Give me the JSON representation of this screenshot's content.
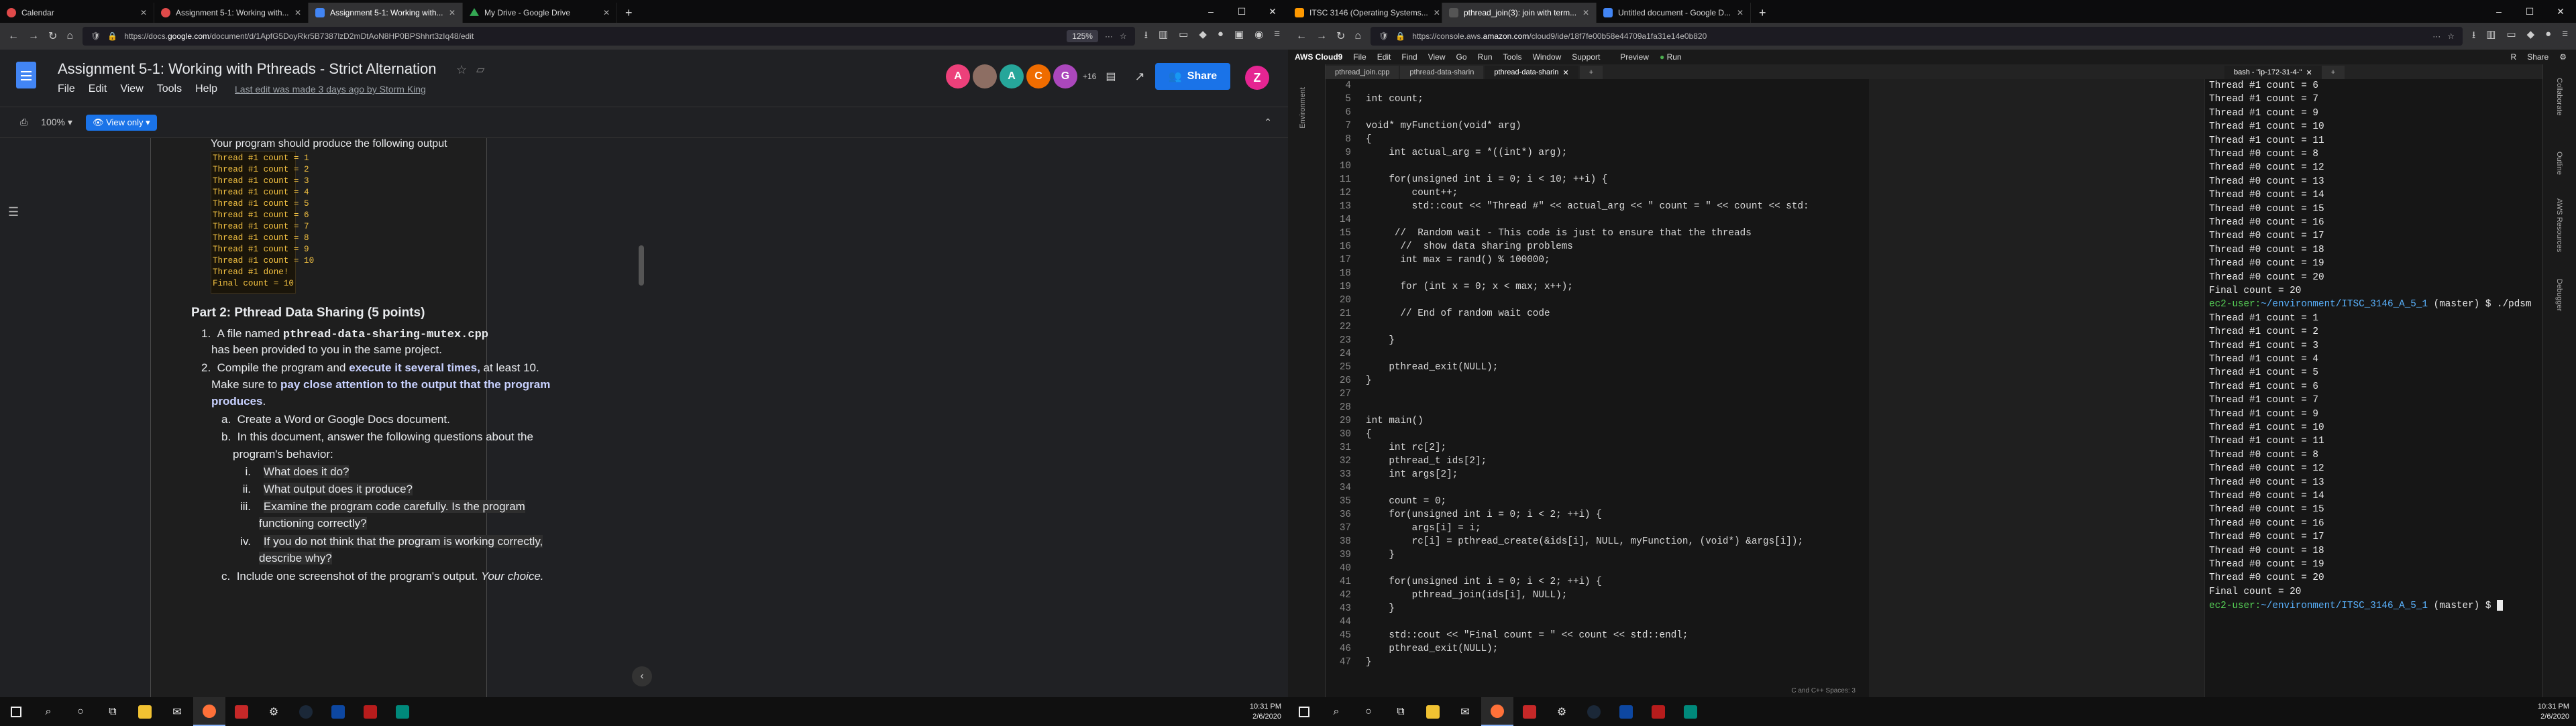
{
  "left": {
    "tabs": [
      {
        "label": "Calendar",
        "color": "#e04a4a"
      },
      {
        "label": "Assignment 5-1: Working with...",
        "color": "#e04a4a"
      },
      {
        "label": "Assignment 5-1: Working with...",
        "color": "#4285f4"
      },
      {
        "label": "My Drive - Google Drive",
        "color": "#34a853"
      }
    ],
    "url_prefix": "https://docs.",
    "url_domain": "google.com",
    "url_rest": "/document/d/1ApfG5DoyRkr5B7387lzD2mDtAoN8HP0BPShhrt3zIq48/edit",
    "zoom": "125%",
    "doc_title": "Assignment 5-1: Working with Pthreads - Strict Alternation",
    "menu": [
      "File",
      "Edit",
      "View",
      "Tools",
      "Help"
    ],
    "last_edit": "Last edit was made 3 days ago by Storm King",
    "avatars": [
      {
        "letter": "A",
        "color": "#ec407a"
      },
      {
        "letter": "",
        "color": "#8d6e63"
      },
      {
        "letter": "A",
        "color": "#26a69a"
      },
      {
        "letter": "C",
        "color": "#ef6c00"
      },
      {
        "letter": "G",
        "color": "#ab47bc"
      }
    ],
    "avatar_more": "+16",
    "share_label": "Share",
    "profile_letter": "Z",
    "zoom_select": "100%",
    "view_only": "View only",
    "output_intro": "Your program should produce the following output",
    "output_lines": [
      "Thread #1 count = 1",
      "Thread #1 count = 2",
      "Thread #1 count = 3",
      "Thread #1 count = 4",
      "Thread #1 count = 5",
      "Thread #1 count = 6",
      "Thread #1 count = 7",
      "Thread #1 count = 8",
      "Thread #1 count = 9",
      "Thread #1 count = 10",
      "Thread #1 done!",
      "Final count = 10"
    ],
    "part2_heading": "Part 2: Pthread Data Sharing (5 points)",
    "item1_num": "1.",
    "item1_a": "A file named ",
    "item1_file": "pthread-data-sharing-mutex.cpp",
    "item1_b": "has been provided to you in the same project.",
    "item2_num": "2.",
    "item2_a": "Compile the program and ",
    "item2_bold": "execute it several times,",
    "item2_c": " at least 10.",
    "item2_d": "Make sure to ",
    "item2_e": "pay close attention to the output that the program",
    "item2_f": "produces",
    "item2_g": ".",
    "sub_a_num": "a.",
    "sub_a": "Create a Word or Google Docs document.",
    "sub_b_num": "b.",
    "sub_b1": "In this document, answer the following questions about the",
    "sub_b2": "program's behavior:",
    "q1_num": "i.",
    "q1": "What does it do?",
    "q2_num": "ii.",
    "q2": "What output does it produce?",
    "q3_num": "iii.",
    "q3a": "Examine the program code carefully. Is the program",
    "q3b": "functioning correctly?",
    "q4_num": "iv.",
    "q4a": "If you do not think that the program is working correctly,",
    "q4b": "describe why?",
    "sub_c_num": "c.",
    "sub_c": "Include one screenshot of the program's output. ",
    "sub_c_it": "Your choice.",
    "time": "10:31 PM",
    "date": "2/6/2020"
  },
  "right": {
    "tabs": [
      {
        "label": "ITSC 3146 (Operating Systems...",
        "color": "#ff9900"
      },
      {
        "label": "pthread_join(3): join with term...",
        "color": "#555555"
      },
      {
        "label": "Untitled document - Google D...",
        "color": "#4285f4"
      }
    ],
    "url_prefix": "https://console.aws.",
    "url_domain": "amazon.com",
    "url_rest": "/cloud9/ide/18f7fe00b58e44709a1fa31e14e0b820",
    "c9_brand": "AWS Cloud9",
    "c9_menu": [
      "File",
      "Edit",
      "Find",
      "View",
      "Go",
      "Run",
      "Tools",
      "Window",
      "Support"
    ],
    "c9_preview": "Preview",
    "c9_run": "Run",
    "c9_share": "Share",
    "editor_tabs": [
      "pthread_join.cpp",
      "pthread-data-sharin",
      "pthread-data-sharin"
    ],
    "term_tab": "bash - \"ip-172-31-4-\"",
    "side_label": "Environment",
    "rail_labels": [
      "Collaborate",
      "Outline",
      "AWS Resources",
      "Debugger"
    ],
    "code_lines": [
      {
        "n": "4",
        "t": ""
      },
      {
        "n": "5",
        "t": "int count;"
      },
      {
        "n": "6",
        "t": ""
      },
      {
        "n": "7",
        "t": "void* myFunction(void* arg)"
      },
      {
        "n": "8",
        "t": "{"
      },
      {
        "n": "9",
        "t": "    int actual_arg = *((int*) arg);"
      },
      {
        "n": "10",
        "t": ""
      },
      {
        "n": "11",
        "t": "    for(unsigned int i = 0; i < 10; ++i) {"
      },
      {
        "n": "12",
        "t": "        count++;"
      },
      {
        "n": "13",
        "t": "        std::cout << \"Thread #\" << actual_arg << \" count = \" << count << std:"
      },
      {
        "n": "14",
        "t": ""
      },
      {
        "n": "15",
        "t": "     //  Random wait - This code is just to ensure that the threads"
      },
      {
        "n": "16",
        "t": "      //  show data sharing problems"
      },
      {
        "n": "17",
        "t": "      int max = rand() % 100000;"
      },
      {
        "n": "18",
        "t": ""
      },
      {
        "n": "19",
        "t": "      for (int x = 0; x < max; x++);"
      },
      {
        "n": "20",
        "t": ""
      },
      {
        "n": "21",
        "t": "      // End of random wait code"
      },
      {
        "n": "22",
        "t": ""
      },
      {
        "n": "23",
        "t": "    }"
      },
      {
        "n": "24",
        "t": ""
      },
      {
        "n": "25",
        "t": "    pthread_exit(NULL);"
      },
      {
        "n": "26",
        "t": "}"
      },
      {
        "n": "27",
        "t": ""
      },
      {
        "n": "28",
        "t": ""
      },
      {
        "n": "29",
        "t": "int main()"
      },
      {
        "n": "30",
        "t": "{"
      },
      {
        "n": "31",
        "t": "    int rc[2];"
      },
      {
        "n": "32",
        "t": "    pthread_t ids[2];"
      },
      {
        "n": "33",
        "t": "    int args[2];"
      },
      {
        "n": "34",
        "t": ""
      },
      {
        "n": "35",
        "t": "    count = 0;"
      },
      {
        "n": "36",
        "t": "    for(unsigned int i = 0; i < 2; ++i) {"
      },
      {
        "n": "37",
        "t": "        args[i] = i;"
      },
      {
        "n": "38",
        "t": "        rc[i] = pthread_create(&ids[i], NULL, myFunction, (void*) &args[i]);"
      },
      {
        "n": "39",
        "t": "    }"
      },
      {
        "n": "40",
        "t": ""
      },
      {
        "n": "41",
        "t": "    for(unsigned int i = 0; i < 2; ++i) {"
      },
      {
        "n": "42",
        "t": "        pthread_join(ids[i], NULL);"
      },
      {
        "n": "43",
        "t": "    }"
      },
      {
        "n": "44",
        "t": ""
      },
      {
        "n": "45",
        "t": "    std::cout << \"Final count = \" << count << std::endl;"
      },
      {
        "n": "46",
        "t": "    pthread_exit(NULL);"
      },
      {
        "n": "47",
        "t": "}"
      }
    ],
    "editor_status": "C and C++   Spaces: 3",
    "term_lines": [
      {
        "t": "Thread #1 count = 6"
      },
      {
        "t": "Thread #1 count = 7"
      },
      {
        "t": "Thread #1 count = 9"
      },
      {
        "t": "Thread #1 count = 10"
      },
      {
        "t": "Thread #1 count = 11"
      },
      {
        "t": "Thread #0 count = 8"
      },
      {
        "t": "Thread #0 count = 12"
      },
      {
        "t": "Thread #0 count = 13"
      },
      {
        "t": "Thread #0 count = 14"
      },
      {
        "t": "Thread #0 count = 15"
      },
      {
        "t": "Thread #0 count = 16"
      },
      {
        "t": "Thread #0 count = 17"
      },
      {
        "t": "Thread #0 count = 18"
      },
      {
        "t": "Thread #0 count = 19"
      },
      {
        "t": "Thread #0 count = 20"
      },
      {
        "t": "Final count = 20"
      },
      {
        "p": "ec2-user:",
        "d": "~/environment/ITSC_3146_A_5_1",
        "c": " (master) $ ./pdsm"
      },
      {
        "t": "Thread #1 count = 1"
      },
      {
        "t": "Thread #1 count = 2"
      },
      {
        "t": "Thread #1 count = 3"
      },
      {
        "t": "Thread #1 count = 4"
      },
      {
        "t": "Thread #1 count = 5"
      },
      {
        "t": "Thread #1 count = 6"
      },
      {
        "t": "Thread #1 count = 7"
      },
      {
        "t": "Thread #1 count = 9"
      },
      {
        "t": "Thread #1 count = 10"
      },
      {
        "t": "Thread #1 count = 11"
      },
      {
        "t": "Thread #0 count = 8"
      },
      {
        "t": "Thread #0 count = 12"
      },
      {
        "t": "Thread #0 count = 13"
      },
      {
        "t": "Thread #0 count = 14"
      },
      {
        "t": "Thread #0 count = 15"
      },
      {
        "t": "Thread #0 count = 16"
      },
      {
        "t": "Thread #0 count = 17"
      },
      {
        "t": "Thread #0 count = 18"
      },
      {
        "t": "Thread #0 count = 19"
      },
      {
        "t": "Thread #0 count = 20"
      },
      {
        "t": "Final count = 20"
      },
      {
        "p": "ec2-user:",
        "d": "~/environment/ITSC_3146_A_5_1",
        "c": " (master) $ "
      }
    ],
    "time": "10:31 PM",
    "date": "2/6/2020"
  }
}
